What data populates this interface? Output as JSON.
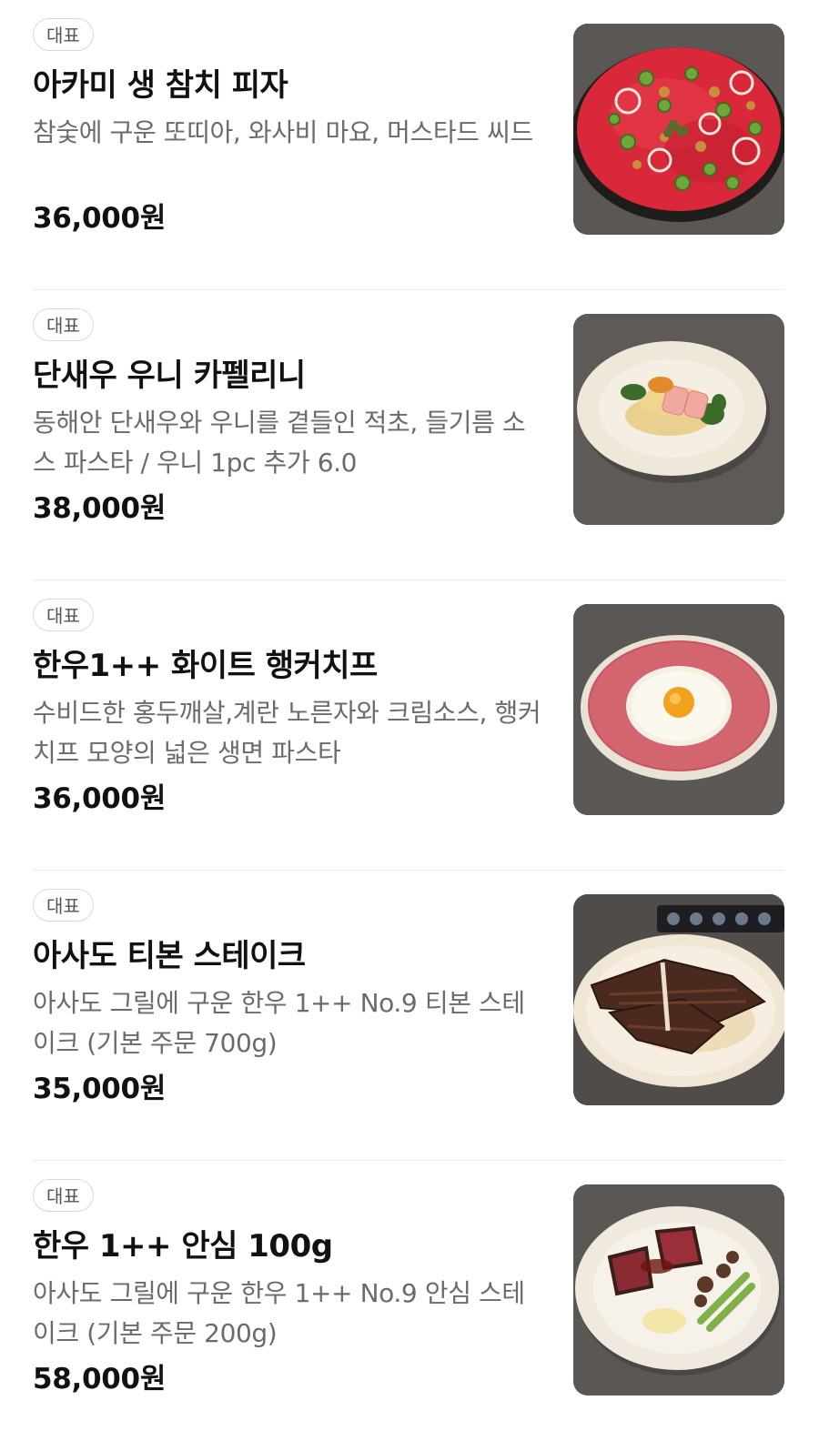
{
  "menu": {
    "items": [
      {
        "badge": "대표",
        "name": "아카미 생 참치 피자",
        "description": "참숯에 구운 또띠아, 와사비 마요, 머스타드 씨드",
        "price": "36,000원",
        "image": "tuna-pizza-photo"
      },
      {
        "badge": "대표",
        "name": "단새우 우니 카펠리니",
        "description": "동해안 단새우와 우니를 곁들인 적초, 들기름 소스 파스타 / 우니 1pc 추가 6.0",
        "price": "38,000원",
        "image": "shrimp-uni-capellini-photo"
      },
      {
        "badge": "대표",
        "name": "한우1++ 화이트 행커치프",
        "description": "수비드한 홍두깨살,계란 노른자와 크림소스, 행커치프 모양의 넓은 생면 파스타",
        "price": "36,000원",
        "image": "white-handkerchief-pasta-photo"
      },
      {
        "badge": "대표",
        "name": "아사도 티본 스테이크",
        "description": "아사도 그릴에 구운 한우 1++ No.9 티본 스테이크 (기본 주문 700g)",
        "price": "35,000원",
        "image": "tbone-steak-photo"
      },
      {
        "badge": "대표",
        "name": "한우 1++ 안심 100g",
        "description": "아사도 그릴에 구운 한우 1++ No.9 안심 스테이크 (기본 주문 200g)",
        "price": "58,000원",
        "image": "tenderloin-steak-photo"
      }
    ]
  }
}
